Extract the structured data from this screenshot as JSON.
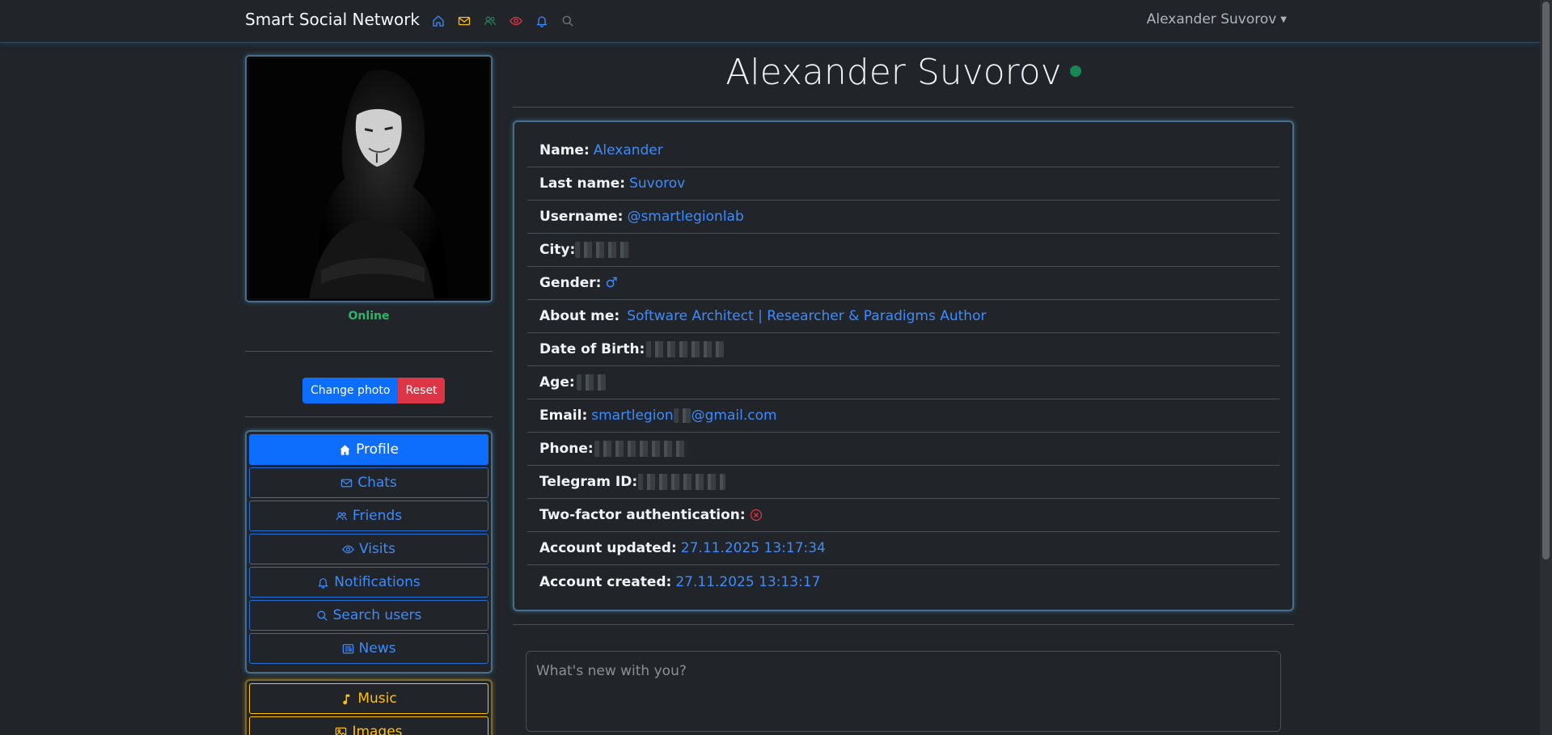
{
  "navbar": {
    "brand": "Smart Social Network",
    "icons": [
      {
        "name": "home-icon",
        "color": "#3d8bfd"
      },
      {
        "name": "envelope-icon",
        "color": "#ffc107"
      },
      {
        "name": "people-icon",
        "color": "#198754"
      },
      {
        "name": "eye-icon",
        "color": "#dc3545"
      },
      {
        "name": "bell-icon",
        "color": "#3d8bfd"
      },
      {
        "name": "search-icon",
        "color": "#6c757d"
      }
    ],
    "user_name": "Alexander Suvorov"
  },
  "sidebar": {
    "status": "Online",
    "change_photo_label": "Change photo",
    "reset_label": "Reset",
    "menu": [
      {
        "label": "Profile",
        "icon": "house-icon",
        "active": true
      },
      {
        "label": "Chats",
        "icon": "envelope-icon"
      },
      {
        "label": "Friends",
        "icon": "people-icon"
      },
      {
        "label": "Visits",
        "icon": "eye-icon"
      },
      {
        "label": "Notifications",
        "icon": "bell-icon"
      },
      {
        "label": "Search users",
        "icon": "search-icon"
      },
      {
        "label": "News",
        "icon": "newspaper-icon"
      }
    ],
    "menu2": [
      {
        "label": "Music",
        "icon": "music-note-icon"
      },
      {
        "label": "Images",
        "icon": "image-icon"
      }
    ]
  },
  "profile": {
    "title": "Alexander Suvorov",
    "fields": {
      "name_label": "Name:",
      "name_value": "Alexander",
      "lastname_label": "Last name:",
      "lastname_value": "Suvorov",
      "username_label": "Username:",
      "username_value": "@smartlegionlab",
      "city_label": "City:",
      "gender_label": "Gender:",
      "gender_value": "♂",
      "about_label": "About me:",
      "about_value": "Software Architect | Researcher & Paradigms Author",
      "dob_label": "Date of Birth:",
      "age_label": "Age:",
      "email_label": "Email:",
      "email_value_start": "smartlegion",
      "email_value_end": "@gmail.com",
      "phone_label": "Phone:",
      "telegram_label": "Telegram ID:",
      "twofa_label": "Two-factor authentication:",
      "updated_label": "Account updated:",
      "updated_value": "27.11.2025 13:17:34",
      "created_label": "Account created:",
      "created_value": "27.11.2025 13:13:17"
    }
  },
  "post": {
    "placeholder": "What's new with you?"
  },
  "colors": {
    "accent": "#0d6efd",
    "link": "#3d8bfd",
    "danger": "#dc3545",
    "success": "#198754",
    "warning": "#ffc107"
  }
}
